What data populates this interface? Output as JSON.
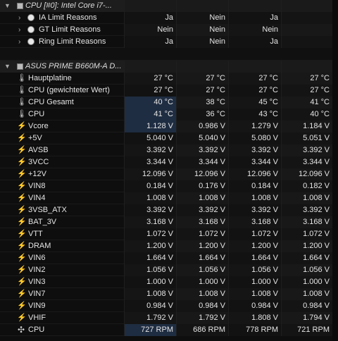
{
  "cpu_group": {
    "title": "CPU [#0]: Intel Core i7-...",
    "rows": [
      {
        "label": "IA Limit Reasons",
        "v": [
          "Ja",
          "Nein",
          "Ja",
          ""
        ]
      },
      {
        "label": "GT Limit Reasons",
        "v": [
          "Nein",
          "Nein",
          "Nein",
          ""
        ]
      },
      {
        "label": "Ring Limit Reasons",
        "v": [
          "Ja",
          "Nein",
          "Ja",
          ""
        ]
      }
    ]
  },
  "board_group": {
    "title": "ASUS PRIME B660M-A D...",
    "rows": [
      {
        "icon": "thermometer-icon",
        "label": "Hauptplatine",
        "v": [
          "27 °C",
          "27 °C",
          "27 °C",
          "27 °C"
        ]
      },
      {
        "icon": "thermometer-icon",
        "label": "CPU (gewichteter Wert)",
        "v": [
          "27 °C",
          "27 °C",
          "27 °C",
          "27 °C"
        ]
      },
      {
        "icon": "thermometer-icon",
        "label": "CPU Gesamt",
        "v": [
          "40 °C",
          "38 °C",
          "45 °C",
          "41 °C"
        ]
      },
      {
        "icon": "thermometer-icon",
        "label": "CPU",
        "v": [
          "41 °C",
          "36 °C",
          "43 °C",
          "40 °C"
        ]
      },
      {
        "icon": "lightning-icon",
        "label": "Vcore",
        "v": [
          "1.128 V",
          "0.986 V",
          "1.279 V",
          "1.184 V"
        ]
      },
      {
        "icon": "lightning-icon",
        "label": "+5V",
        "v": [
          "5.040 V",
          "5.040 V",
          "5.080 V",
          "5.051 V"
        ]
      },
      {
        "icon": "lightning-icon",
        "label": "AVSB",
        "v": [
          "3.392 V",
          "3.392 V",
          "3.392 V",
          "3.392 V"
        ]
      },
      {
        "icon": "lightning-icon",
        "label": "3VCC",
        "v": [
          "3.344 V",
          "3.344 V",
          "3.344 V",
          "3.344 V"
        ]
      },
      {
        "icon": "lightning-icon",
        "label": "+12V",
        "v": [
          "12.096 V",
          "12.096 V",
          "12.096 V",
          "12.096 V"
        ]
      },
      {
        "icon": "lightning-icon",
        "label": "VIN8",
        "v": [
          "0.184 V",
          "0.176 V",
          "0.184 V",
          "0.182 V"
        ]
      },
      {
        "icon": "lightning-icon",
        "label": "VIN4",
        "v": [
          "1.008 V",
          "1.008 V",
          "1.008 V",
          "1.008 V"
        ]
      },
      {
        "icon": "lightning-icon",
        "label": "3VSB_ATX",
        "v": [
          "3.392 V",
          "3.392 V",
          "3.392 V",
          "3.392 V"
        ]
      },
      {
        "icon": "lightning-icon",
        "label": "BAT_3V",
        "v": [
          "3.168 V",
          "3.168 V",
          "3.168 V",
          "3.168 V"
        ]
      },
      {
        "icon": "lightning-icon",
        "label": "VTT",
        "v": [
          "1.072 V",
          "1.072 V",
          "1.072 V",
          "1.072 V"
        ]
      },
      {
        "icon": "lightning-icon",
        "label": "DRAM",
        "v": [
          "1.200 V",
          "1.200 V",
          "1.200 V",
          "1.200 V"
        ]
      },
      {
        "icon": "lightning-icon",
        "label": "VIN6",
        "v": [
          "1.664 V",
          "1.664 V",
          "1.664 V",
          "1.664 V"
        ]
      },
      {
        "icon": "lightning-icon",
        "label": "VIN2",
        "v": [
          "1.056 V",
          "1.056 V",
          "1.056 V",
          "1.056 V"
        ]
      },
      {
        "icon": "lightning-icon",
        "label": "VIN3",
        "v": [
          "1.000 V",
          "1.000 V",
          "1.000 V",
          "1.000 V"
        ]
      },
      {
        "icon": "lightning-icon",
        "label": "VIN7",
        "v": [
          "1.008 V",
          "1.008 V",
          "1.008 V",
          "1.008 V"
        ]
      },
      {
        "icon": "lightning-icon",
        "label": "VIN9",
        "v": [
          "0.984 V",
          "0.984 V",
          "0.984 V",
          "0.984 V"
        ]
      },
      {
        "icon": "lightning-icon",
        "label": "VHIF",
        "v": [
          "1.792 V",
          "1.792 V",
          "1.808 V",
          "1.794 V"
        ]
      },
      {
        "icon": "fan-icon",
        "label": "CPU",
        "v": [
          "727 RPM",
          "686 RPM",
          "778 RPM",
          "721 RPM"
        ]
      }
    ]
  },
  "colors": {
    "highlight": "#1f2d42",
    "volt_icon": "#f2c318"
  }
}
